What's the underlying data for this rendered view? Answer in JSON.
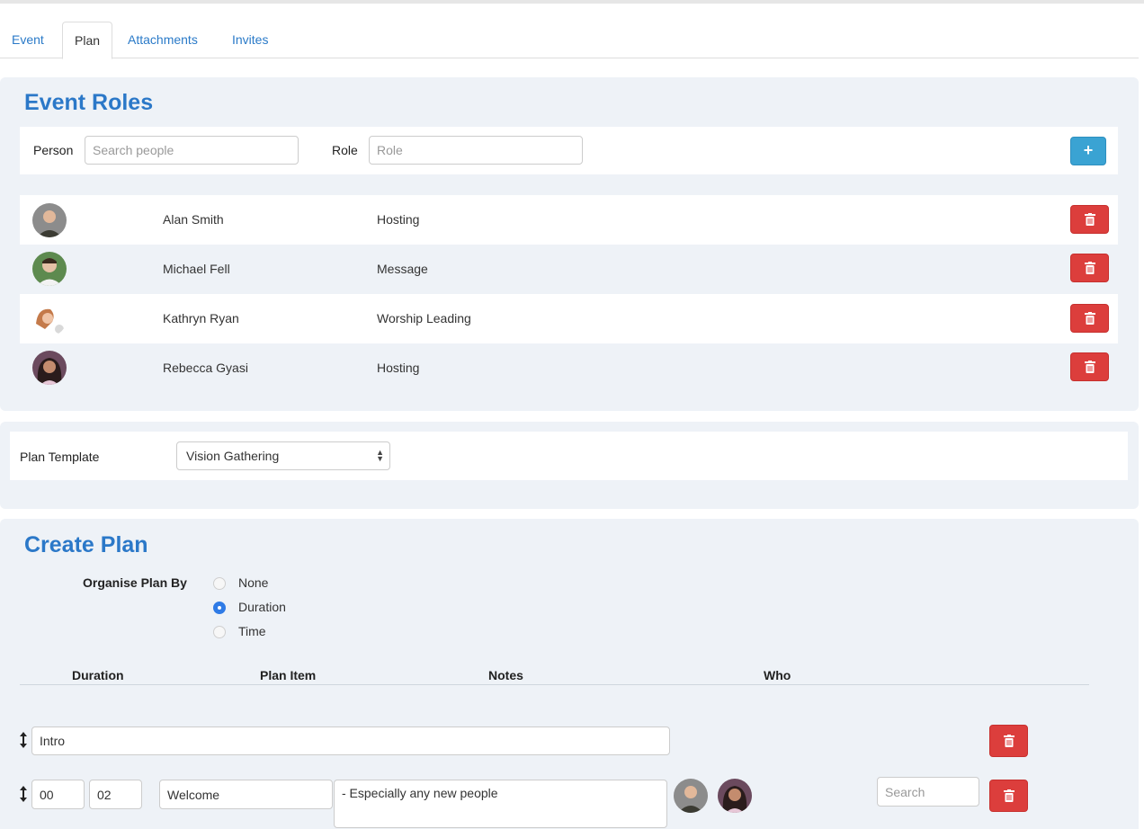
{
  "tabs": [
    {
      "label": "Event"
    },
    {
      "label": "Plan"
    },
    {
      "label": "Attachments"
    },
    {
      "label": "Invites"
    }
  ],
  "event_roles": {
    "title": "Event Roles",
    "person_label": "Person",
    "person_placeholder": "Search people",
    "role_label": "Role",
    "role_placeholder": "Role",
    "add_button": "+",
    "people": [
      {
        "name": "Alan Smith",
        "role": "Hosting"
      },
      {
        "name": "Michael Fell",
        "role": "Message"
      },
      {
        "name": "Kathryn Ryan",
        "role": "Worship Leading"
      },
      {
        "name": "Rebecca Gyasi",
        "role": "Hosting"
      }
    ]
  },
  "plan_template": {
    "label": "Plan Template",
    "selected": "Vision Gathering"
  },
  "create_plan": {
    "title": "Create Plan",
    "organise_label": "Organise Plan By",
    "options": [
      "None",
      "Duration",
      "Time"
    ],
    "selected_option": "Duration",
    "columns": [
      "Duration",
      "Plan Item",
      "Notes",
      "Who"
    ],
    "items": [
      {
        "title": "Intro"
      },
      {
        "hours": "00",
        "minutes": "02",
        "item": "Welcome",
        "notes": "- Especially any new people",
        "who_search_placeholder": "Search"
      }
    ]
  },
  "colors": {
    "accent": "#2b78c8",
    "panel_bg": "#eef2f7",
    "danger": "#dc3e3c",
    "info": "#3aa3d3",
    "radio_selected": "#2f7be6"
  },
  "icons": [
    "plus-icon",
    "trash-icon",
    "drag-handle-icon",
    "select-arrows-icon"
  ]
}
